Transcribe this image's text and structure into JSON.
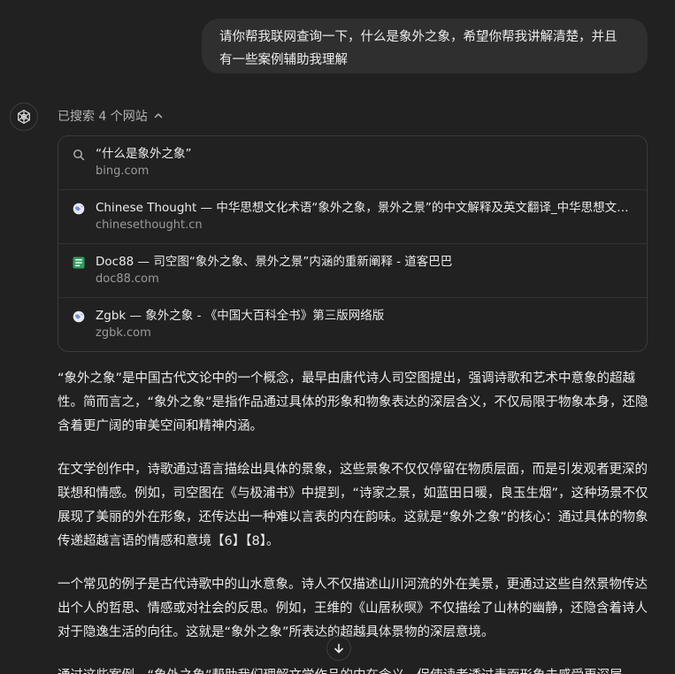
{
  "user_message": {
    "line1": "请你帮我联网查询一下，什么是象外之象，希望你帮我讲解清楚，并且",
    "line2": "有一些案例辅助我理解"
  },
  "assistant": {
    "avatar_icon": "openai-logo-icon",
    "search_summary": "已搜索 4 个网站",
    "sources": [
      {
        "icon": "search-icon",
        "title": "“什么是象外之象”",
        "domain": "bing.com"
      },
      {
        "icon": "globe-icon",
        "title": "Chinese Thought — 中华思想文化术语“象外之象，景外之景”的中文解释及英文翻译_中华思想文化术语",
        "domain": "chinesethought.cn"
      },
      {
        "icon": "doc88-icon",
        "title": "Doc88 — 司空图“象外之象、景外之景”内涵的重新阐释 - 道客巴巴",
        "domain": "doc88.com"
      },
      {
        "icon": "globe-icon",
        "title": "Zgbk — 象外之象 - 《中国大百科全书》第三版网络版",
        "domain": "zgbk.com"
      }
    ],
    "paragraphs": [
      "“象外之象”是中国古代文论中的一个概念，最早由唐代诗人司空图提出，强调诗歌和艺术中意象的超越性。简而言之，“象外之象”是指作品通过具体的形象和物象表达的深层含义，不仅局限于物象本身，还隐含着更广阔的审美空间和精神内涵。",
      "在文学创作中，诗歌通过语言描绘出具体的景象，这些景象不仅仅停留在物质层面，而是引发观者更深的联想和情感。例如，司空图在《与极浦书》中提到，“诗家之景，如蓝田日暖，良玉生烟”，这种场景不仅展现了美丽的外在形象，还传达出一种难以言表的内在韵味。这就是“象外之象”的核心：通过具体的物象传递超越言语的情感和意境【6】【8】。",
      "一个常见的例子是古代诗歌中的山水意象。诗人不仅描述山川河流的外在美景，更通过这些自然景物传达出个人的哲思、情感或对社会的反思。例如，王维的《山居秋暝》不仅描绘了山林的幽静，还隐含着诗人对于隐逸生活的向往。这就是“象外之象”所表达的超越具体景物的深层意境。",
      "通过这些案例，“象外之象”帮助我们理解文学作品的内在含义，促使读者透过表面形象去感受更深层"
    ]
  },
  "colors": {
    "background": "#212121",
    "user_bubble": "#2f2f2f",
    "text": "#ececec",
    "muted": "#9b9b9b",
    "border": "#3a3a3a",
    "doc88_green": "#2e9e5b",
    "globe_blue": "#6f8fe0"
  }
}
